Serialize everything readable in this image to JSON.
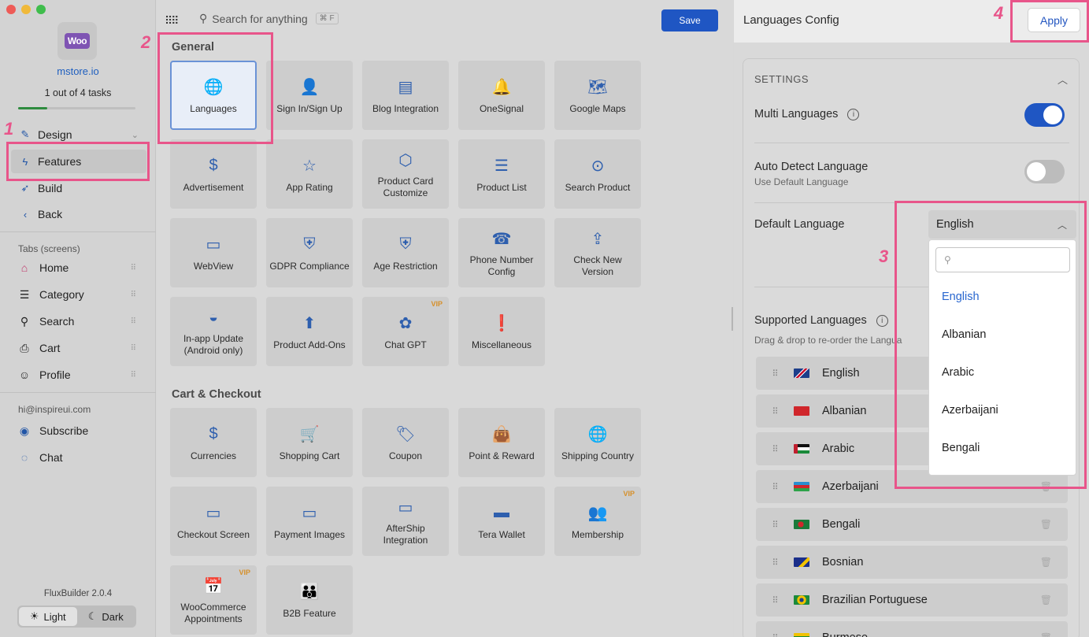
{
  "sidebar": {
    "store_name": "mstore.io",
    "tasks": "1 out of 4 tasks",
    "progress": 0.25,
    "nav": [
      {
        "label": "Design",
        "icon": "paintbrush-icon"
      },
      {
        "label": "Features",
        "icon": "lightning-icon"
      },
      {
        "label": "Build",
        "icon": "rocket-icon"
      },
      {
        "label": "Back",
        "icon": "chevron-left-icon"
      }
    ],
    "tabs_label": "Tabs (screens)",
    "tabs": [
      {
        "label": "Home",
        "icon": "home-icon"
      },
      {
        "label": "Category",
        "icon": "category-icon"
      },
      {
        "label": "Search",
        "icon": "search-icon"
      },
      {
        "label": "Cart",
        "icon": "cart-icon"
      },
      {
        "label": "Profile",
        "icon": "profile-icon"
      }
    ],
    "email": "hi@inspireui.com",
    "subscribe": "Subscribe",
    "chat": "Chat",
    "version": "FluxBuilder 2.0.4",
    "theme_light": "Light",
    "theme_dark": "Dark"
  },
  "toolbar": {
    "search_placeholder": "Search for anything",
    "shortcut": "⌘ F",
    "save": "Save"
  },
  "sections": {
    "general": "General",
    "cart_checkout": "Cart & Checkout"
  },
  "general_cards": [
    {
      "label": "Languages",
      "icon": "globe-icon",
      "glyph": "🌐",
      "vip": false
    },
    {
      "label": "Sign In/Sign Up",
      "icon": "user-card-icon",
      "glyph": "👤",
      "vip": false
    },
    {
      "label": "Blog Integration",
      "icon": "blog-icon",
      "glyph": "▤",
      "vip": false
    },
    {
      "label": "OneSignal",
      "icon": "bell-icon",
      "glyph": "🔔",
      "vip": false
    },
    {
      "label": "Google Maps",
      "icon": "map-icon",
      "glyph": "🗺",
      "vip": false
    },
    {
      "label": "Advertisement",
      "icon": "dollar-icon",
      "glyph": "$",
      "vip": false
    },
    {
      "label": "App Rating",
      "icon": "star-icon",
      "glyph": "☆",
      "vip": false
    },
    {
      "label": "Product Card Customize",
      "icon": "cube-icon",
      "glyph": "⬡",
      "vip": false
    },
    {
      "label": "Product List",
      "icon": "list-icon",
      "glyph": "☰",
      "vip": false
    },
    {
      "label": "Search Product",
      "icon": "search-circle-icon",
      "glyph": "⊙",
      "vip": false
    },
    {
      "label": "WebView",
      "icon": "webview-icon",
      "glyph": "▭",
      "vip": false
    },
    {
      "label": "GDPR Compliance",
      "icon": "shield-lock-icon",
      "glyph": "⛨",
      "vip": false
    },
    {
      "label": "Age Restriction",
      "icon": "shield-lock-icon",
      "glyph": "⛨",
      "vip": false
    },
    {
      "label": "Phone Number Config",
      "icon": "contact-card-icon",
      "glyph": "☎",
      "vip": false
    },
    {
      "label": "Check New Version",
      "icon": "upload-icon",
      "glyph": "⇪",
      "vip": false
    },
    {
      "label": "In-app Update (Android only)",
      "icon": "android-icon",
      "glyph": "◒",
      "vip": false
    },
    {
      "label": "Product Add-Ons",
      "icon": "upload-arrow-icon",
      "glyph": "⬆",
      "vip": false
    },
    {
      "label": "Chat GPT",
      "icon": "openai-icon",
      "glyph": "✿",
      "vip": true
    },
    {
      "label": "Miscellaneous",
      "icon": "alert-message-icon",
      "glyph": "❗",
      "vip": false
    }
  ],
  "cart_cards": [
    {
      "label": "Currencies",
      "icon": "currency-icon",
      "glyph": "$",
      "vip": false
    },
    {
      "label": "Shopping Cart",
      "icon": "cart-icon",
      "glyph": "🛒",
      "vip": false
    },
    {
      "label": "Coupon",
      "icon": "tag-icon",
      "glyph": "🏷",
      "vip": false
    },
    {
      "label": "Point & Reward",
      "icon": "reward-bag-icon",
      "glyph": "👜",
      "vip": false
    },
    {
      "label": "Shipping Country",
      "icon": "globe-icon",
      "glyph": "🌐",
      "vip": false
    },
    {
      "label": "Checkout Screen",
      "icon": "credit-card-icon",
      "glyph": "▭",
      "vip": false
    },
    {
      "label": "Payment Images",
      "icon": "credit-card-icon",
      "glyph": "▭",
      "vip": false
    },
    {
      "label": "AfterShip Integration",
      "icon": "credit-card-icon",
      "glyph": "▭",
      "vip": false
    },
    {
      "label": "Tera Wallet",
      "icon": "wallet-icon",
      "glyph": "▬",
      "vip": false
    },
    {
      "label": "Membership",
      "icon": "users-icon",
      "glyph": "👥",
      "vip": true
    },
    {
      "label": "WooCommerce Appointments",
      "icon": "calendar-add-icon",
      "glyph": "📅",
      "vip": true
    },
    {
      "label": "B2B Feature",
      "icon": "group-icon",
      "glyph": "👪",
      "vip": false
    }
  ],
  "vip_label": "VIP",
  "config": {
    "title": "Languages Config",
    "apply": "Apply",
    "settings_heading": "SETTINGS",
    "multi_languages": "Multi Languages",
    "multi_languages_on": true,
    "auto_detect": "Auto Detect Language",
    "auto_detect_sub": "Use Default Language",
    "auto_detect_on": false,
    "default_language_label": "Default Language",
    "default_language_value": "English",
    "dropdown_search_placeholder": "",
    "dropdown_options": [
      "English",
      "Albanian",
      "Arabic",
      "Azerbaijani",
      "Bengali"
    ],
    "supported_label": "Supported Languages",
    "supported_sub": "Drag & drop to re-order the Langua",
    "supported": [
      {
        "name": "English",
        "flag": "uk-flag-icon"
      },
      {
        "name": "Albanian",
        "flag": "albania-flag-icon"
      },
      {
        "name": "Arabic",
        "flag": "arabic-flag-icon"
      },
      {
        "name": "Azerbaijani",
        "flag": "azerbaijan-flag-icon"
      },
      {
        "name": "Bengali",
        "flag": "bangladesh-flag-icon"
      },
      {
        "name": "Bosnian",
        "flag": "bosnia-flag-icon"
      },
      {
        "name": "Brazilian Portuguese",
        "flag": "brazil-flag-icon"
      },
      {
        "name": "Burmese",
        "flag": "myanmar-flag-icon"
      }
    ]
  },
  "annotations": [
    "1",
    "2",
    "3",
    "4"
  ],
  "colors": {
    "accent": "#1f56c3",
    "highlight": "#e8558a",
    "vip": "#d6902a"
  }
}
